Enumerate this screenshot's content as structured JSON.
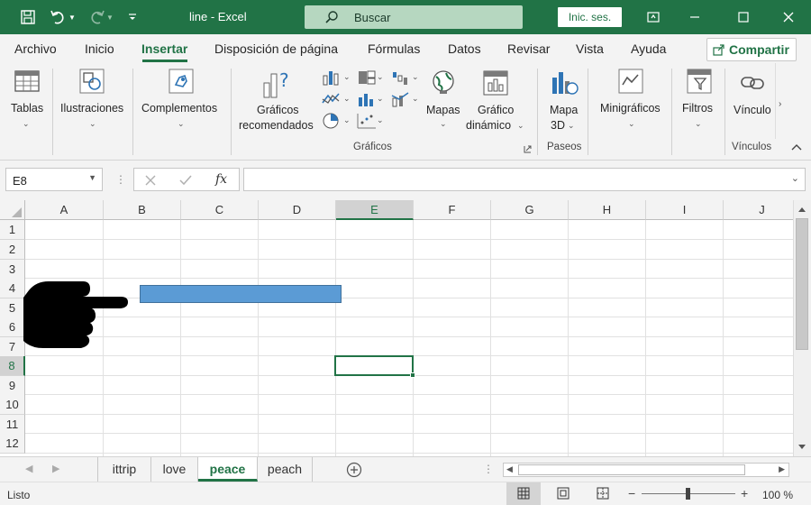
{
  "window": {
    "title": "line  -  Excel",
    "search_label": "Buscar",
    "signin_label": "Inic. ses."
  },
  "ribbon_tabs": [
    "Archivo",
    "Inicio",
    "Insertar",
    "Disposición de página",
    "Fórmulas",
    "Datos",
    "Revisar",
    "Vista",
    "Ayuda"
  ],
  "active_tab": "Insertar",
  "share_label": "Compartir",
  "ribbon": {
    "tablas": "Tablas",
    "ilustraciones": "Ilustraciones",
    "complementos": "Complementos",
    "graficos_recomendados_1": "Gráficos",
    "graficos_recomendados_2": "recomendados",
    "mapas": "Mapas",
    "grafico_dinamico_1": "Gráfico",
    "grafico_dinamico_2": "dinámico",
    "mapa3d_1": "Mapa",
    "mapa3d_2": "3D",
    "minigraficos": "Minigráficos",
    "filtros": "Filtros",
    "vinculos": "Vínculo",
    "group_graficos": "Gráficos",
    "group_paseos": "Paseos",
    "group_vinculos": "Vínculos"
  },
  "formula_bar": {
    "name_box": "E8",
    "fx": "fx",
    "value": ""
  },
  "grid": {
    "columns": [
      "A",
      "B",
      "C",
      "D",
      "E",
      "F",
      "G",
      "H",
      "I",
      "J"
    ],
    "rows": [
      "1",
      "2",
      "3",
      "4",
      "5",
      "6",
      "7",
      "8",
      "9",
      "10",
      "11",
      "12"
    ],
    "selected_cell": "E8"
  },
  "sheets": [
    "ittrip",
    "love",
    "peace",
    "peach"
  ],
  "active_sheet": "peace",
  "status": {
    "ready": "Listo",
    "zoom": "100 %"
  },
  "colors": {
    "excel_green": "#217346",
    "bar_shape": "#5b9bd5"
  }
}
